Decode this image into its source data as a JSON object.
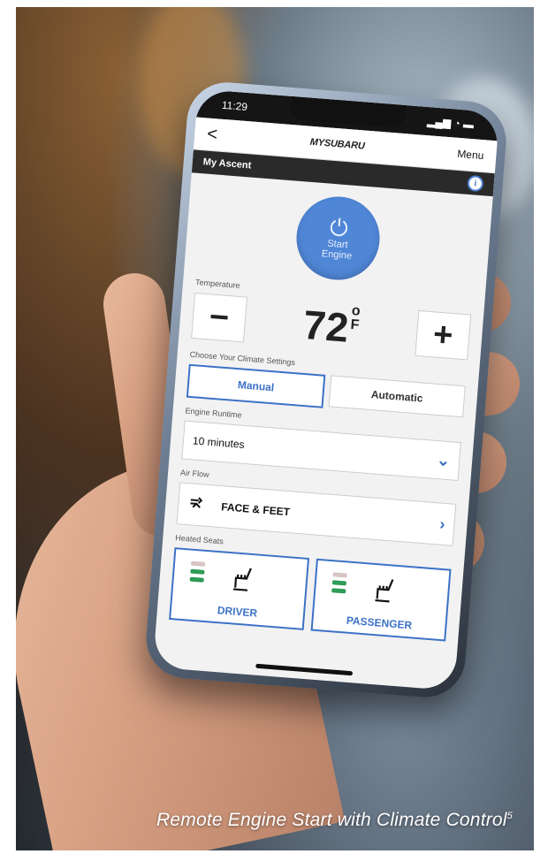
{
  "status": {
    "time": "11:29"
  },
  "header": {
    "back": "<",
    "logo": "MYSUBARU",
    "menu": "Menu"
  },
  "vehicle": {
    "name": "My Ascent",
    "info": "i"
  },
  "start": {
    "label_line1": "Start",
    "label_line2": "Engine",
    "icon": "power-icon"
  },
  "temperature": {
    "label": "Temperature",
    "minus": "−",
    "value": "72",
    "degree": "o",
    "unit": "F",
    "plus": "+"
  },
  "climate": {
    "label": "Choose Your Climate Settings",
    "options": [
      "Manual",
      "Automatic"
    ],
    "selected": "Manual"
  },
  "runtime": {
    "label": "Engine Runtime",
    "value": "10 minutes"
  },
  "airflow": {
    "label": "Air Flow",
    "value": "FACE & FEET"
  },
  "heated_seats": {
    "label": "Heated Seats",
    "seats": [
      {
        "label": "DRIVER"
      },
      {
        "label": "PASSENGER"
      }
    ]
  },
  "caption": {
    "text": "Remote Engine Start with Climate Control",
    "superscript": "5"
  },
  "colors": {
    "accent": "#3c72c6",
    "start_button": "#4f86d6",
    "heat_on": "#2e9b57",
    "heat_off": "#d9c4c4"
  }
}
